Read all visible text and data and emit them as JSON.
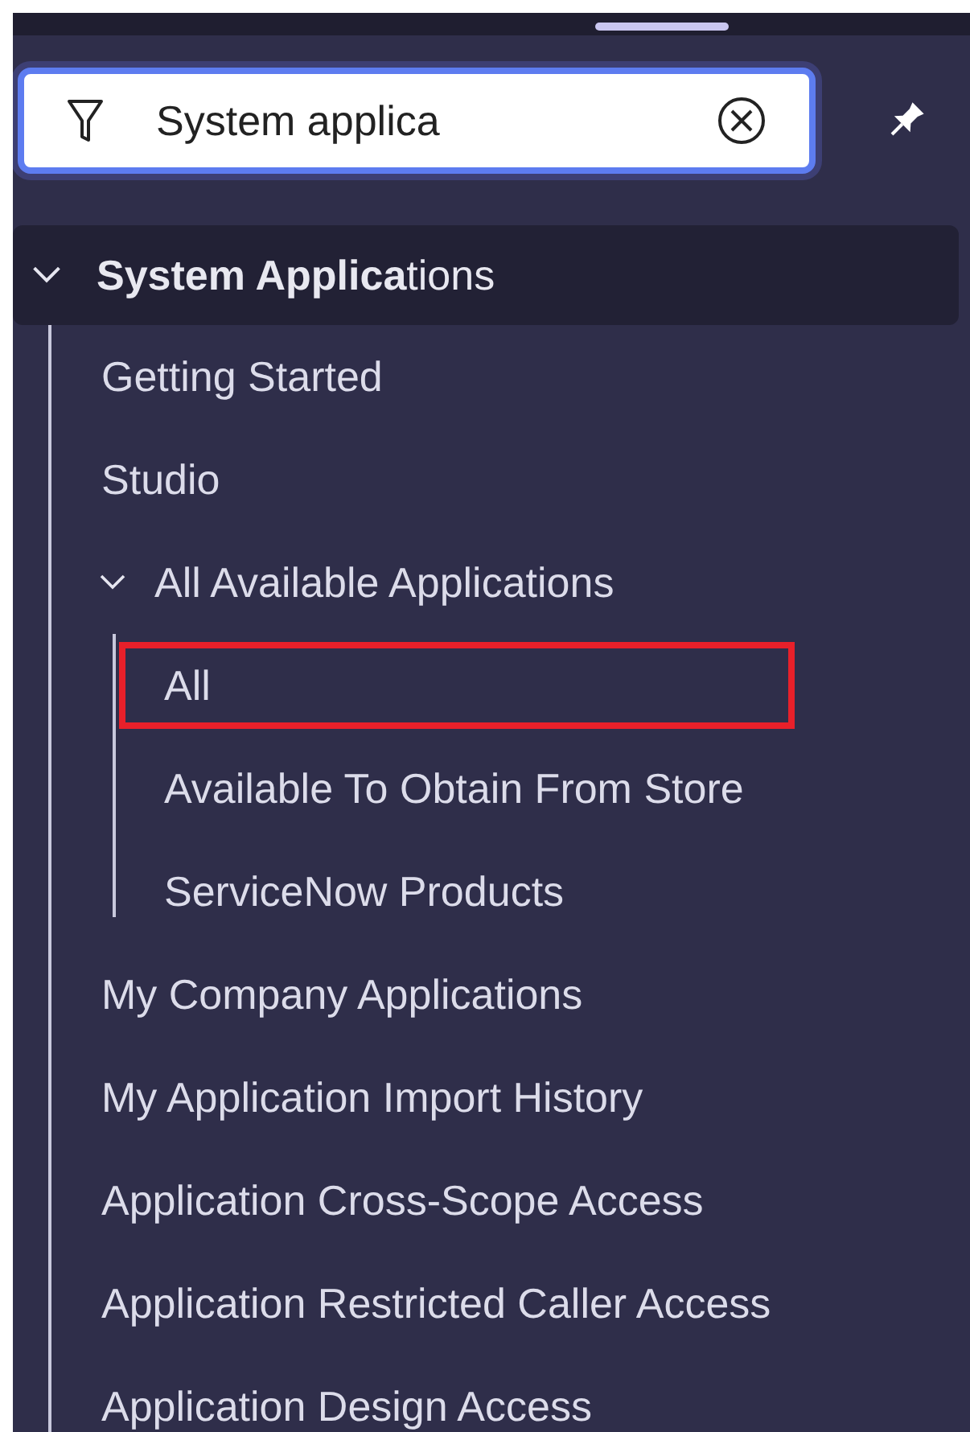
{
  "search": {
    "value": "System applica"
  },
  "section": {
    "label": "**System Applica**tions",
    "expanded": true,
    "children": [
      {
        "label": "Getting Started",
        "highlighted": false
      },
      {
        "label": "Studio",
        "highlighted": false
      },
      {
        "label": "All Available Applications",
        "highlighted": false,
        "expanded": true,
        "children": [
          {
            "label": "All",
            "highlighted": true
          },
          {
            "label": "Available To Obtain From Store",
            "highlighted": false
          },
          {
            "label": "ServiceNow Products",
            "highlighted": false
          }
        ]
      },
      {
        "label": "My Company Applications",
        "highlighted": false
      },
      {
        "label": "My Application Import History",
        "highlighted": false
      },
      {
        "label": "Application Cross-Scope Access",
        "highlighted": false
      },
      {
        "label": "Application Restricted Caller Access",
        "highlighted": false
      },
      {
        "label": "Application Design Access",
        "highlighted": false
      }
    ]
  }
}
